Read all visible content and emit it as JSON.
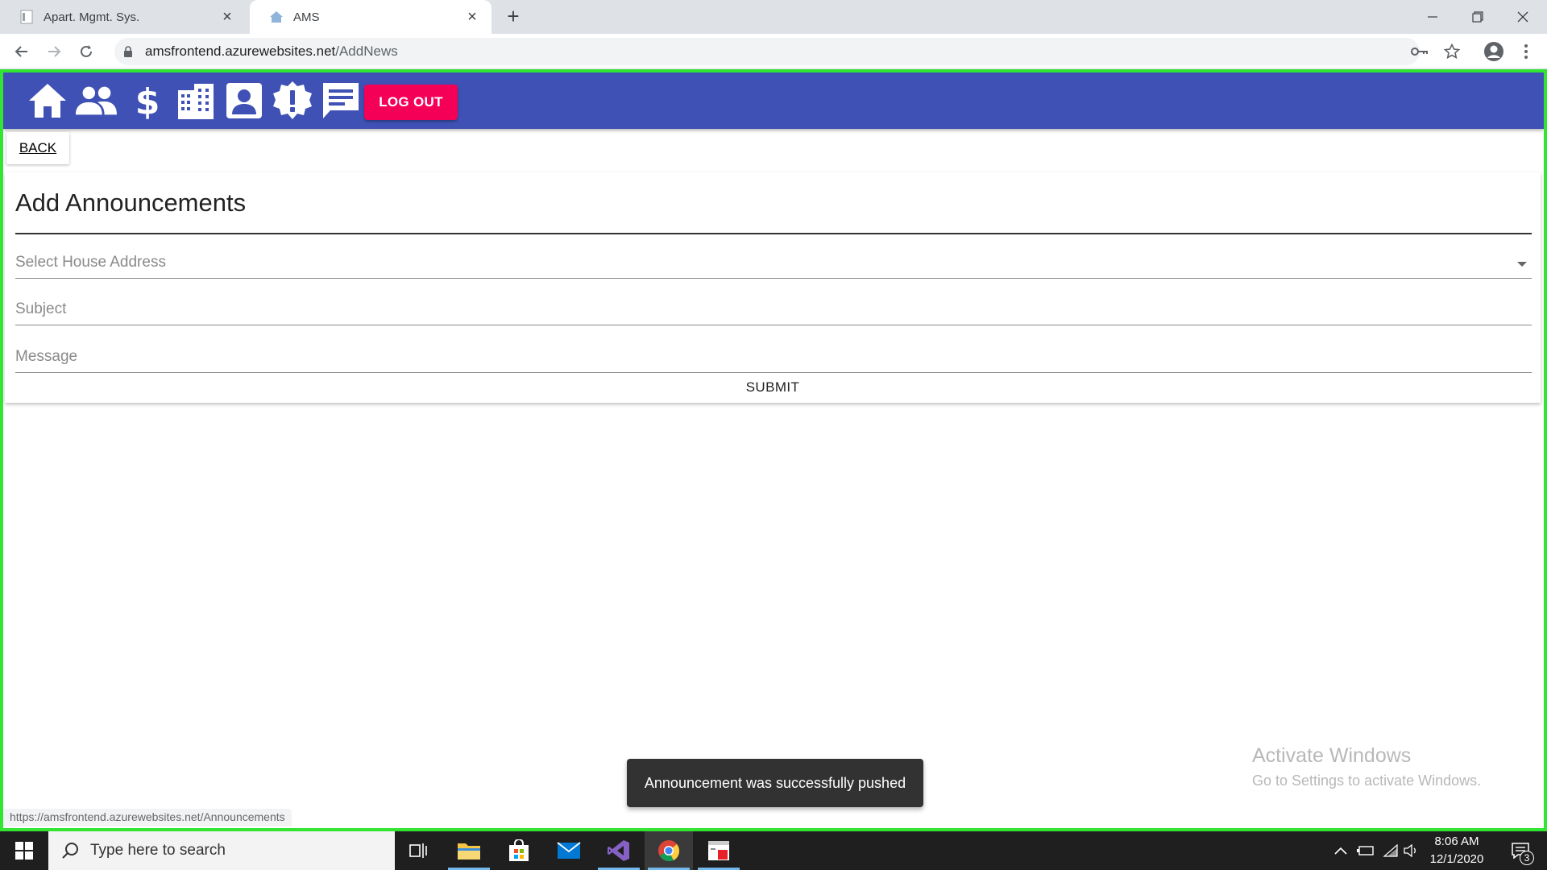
{
  "browser": {
    "tabs": [
      {
        "title": "Apart. Mgmt. Sys.",
        "active": false
      },
      {
        "title": "AMS",
        "active": true
      }
    ],
    "url_host": "amsfrontend.azurewebsites.net",
    "url_path": "/AddNews"
  },
  "appbar": {
    "nav_icons": [
      "home-icon",
      "people-icon",
      "dollar-icon",
      "buildings-icon",
      "account-box-icon",
      "alert-decagram-icon",
      "message-icon"
    ],
    "logout_label": "LOG OUT",
    "color": "#3f51b5",
    "logout_color": "#f50057"
  },
  "page": {
    "back_label": "BACK",
    "heading": "Add Announcements",
    "fields": {
      "house_address": {
        "placeholder": "Select House Address",
        "value": ""
      },
      "subject": {
        "placeholder": "Subject",
        "value": ""
      },
      "message": {
        "placeholder": "Message",
        "value": ""
      }
    },
    "submit_label": "SUBMIT"
  },
  "toast": {
    "text": "Announcement was successfully pushed"
  },
  "watermark": {
    "line1": "Activate Windows",
    "line2": "Go to Settings to activate Windows."
  },
  "status_url": "https://amsfrontend.azurewebsites.net/Announcements",
  "taskbar": {
    "search_placeholder": "Type here to search",
    "time": "8:06 AM",
    "date": "12/1/2020",
    "notification_count": "3"
  }
}
